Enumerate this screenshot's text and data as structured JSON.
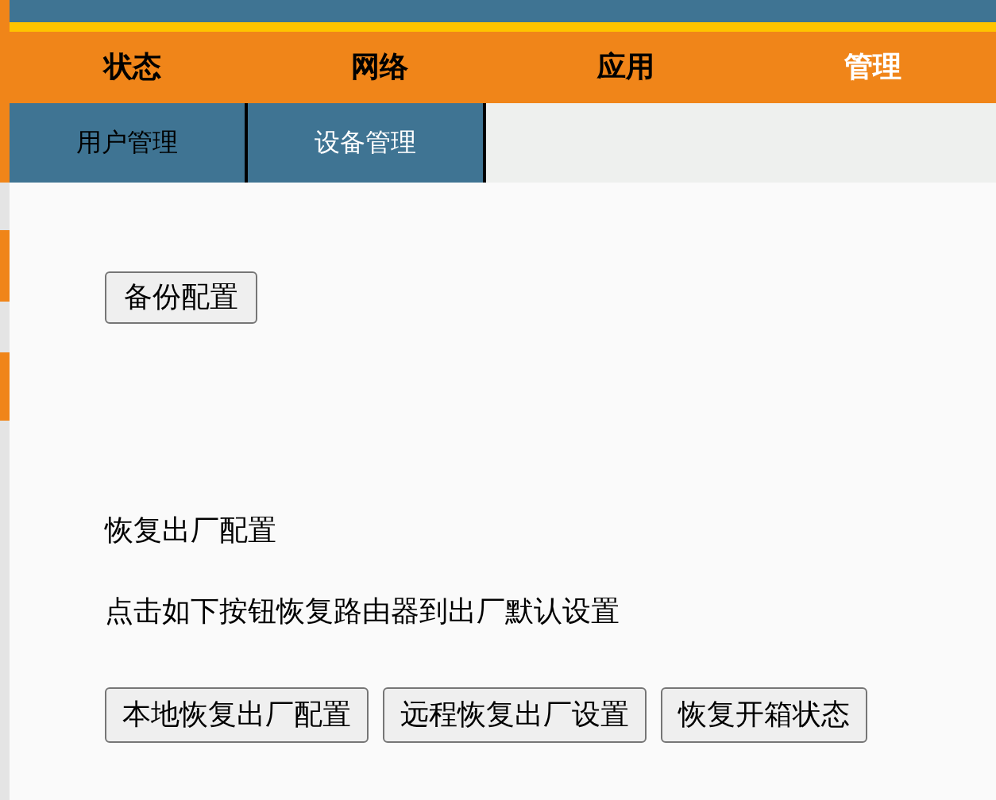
{
  "nav_tabs": [
    {
      "label": "状态",
      "selected": false
    },
    {
      "label": "网络",
      "selected": false
    },
    {
      "label": "应用",
      "selected": false
    },
    {
      "label": "管理",
      "selected": true
    }
  ],
  "sub_tabs": [
    {
      "label": "用户管理",
      "selected": false
    },
    {
      "label": "设备管理",
      "selected": true
    }
  ],
  "backup_button": "备份配置",
  "reset_section": {
    "title": "恢复出厂配置",
    "description": "点击如下按钮恢复路由器到出厂默认设置",
    "buttons": [
      "本地恢复出厂配置",
      "远程恢复出厂设置",
      "恢复开箱状态"
    ]
  }
}
